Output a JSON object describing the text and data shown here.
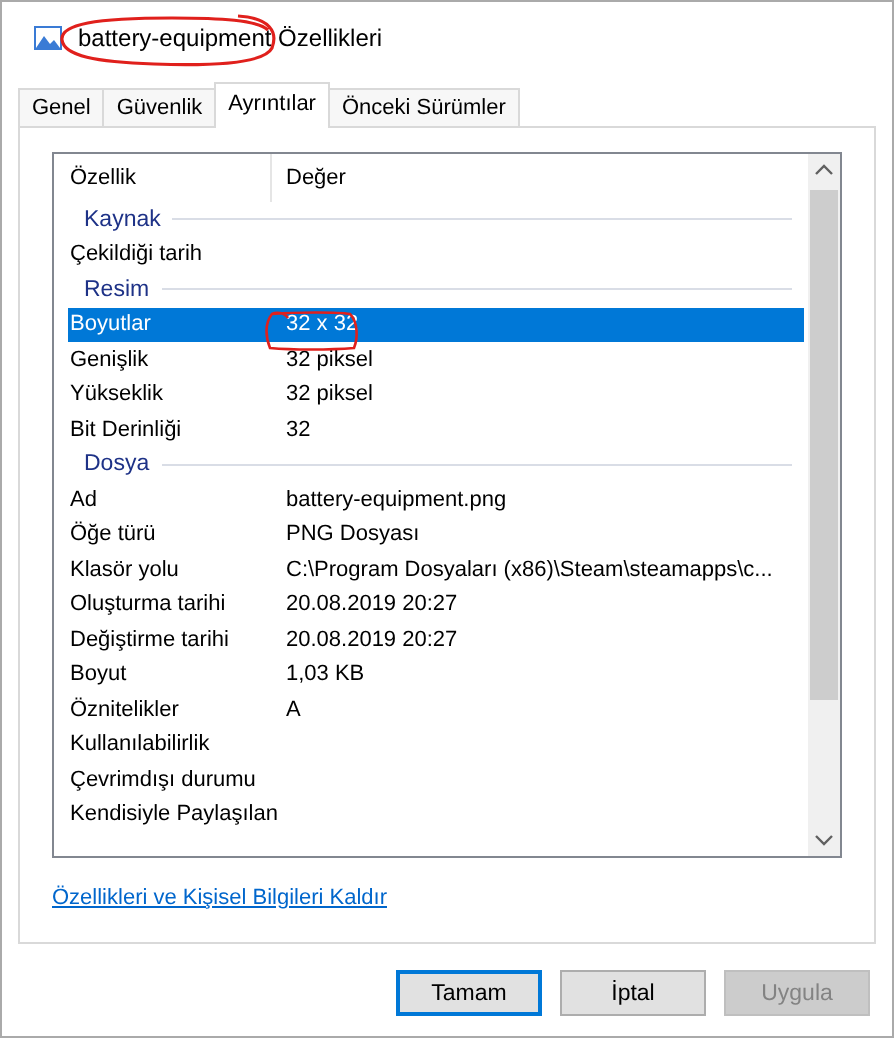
{
  "window": {
    "title": "battery-equipment Özellikleri"
  },
  "tabs": [
    {
      "label": "Genel",
      "selected": false
    },
    {
      "label": "Güvenlik",
      "selected": false
    },
    {
      "label": "Ayrıntılar",
      "selected": true
    },
    {
      "label": "Önceki Sürümler",
      "selected": false
    }
  ],
  "table": {
    "columns": [
      "Özellik",
      "Değer"
    ],
    "rows": [
      {
        "kind": "group",
        "label": "Kaynak"
      },
      {
        "kind": "property",
        "name": "Çekildiği tarih",
        "selected": false
      },
      {
        "kind": "group",
        "label": "Resim"
      },
      {
        "kind": "property",
        "name": "Boyutlar",
        "value": "32 x 32",
        "selected": true
      },
      {
        "kind": "property",
        "name": "Genişlik",
        "value": "32 piksel",
        "selected": false
      },
      {
        "kind": "property",
        "name": "Yükseklik",
        "value": "32 piksel",
        "selected": false
      },
      {
        "kind": "property",
        "name": "Bit Derinliği",
        "value": "32",
        "selected": false
      },
      {
        "kind": "group",
        "label": "Dosya"
      },
      {
        "kind": "property",
        "name": "Ad",
        "value": "battery-equipment.png",
        "selected": false
      },
      {
        "kind": "property",
        "name": "Öğe türü",
        "value": "PNG Dosyası",
        "selected": false
      },
      {
        "kind": "property",
        "name": "Klasör yolu",
        "value": "C:\\Program Dosyaları (x86)\\Steam\\steamapps\\c...",
        "selected": false
      },
      {
        "kind": "property",
        "name": "Oluşturma tarihi",
        "value": "20.08.2019 20:27",
        "selected": false
      },
      {
        "kind": "property",
        "name": "Değiştirme tarihi",
        "value": "20.08.2019 20:27",
        "selected": false
      },
      {
        "kind": "property",
        "name": "Boyut",
        "value": "1,03 KB",
        "selected": false
      },
      {
        "kind": "property",
        "name": "Öznitelikler",
        "value": "A",
        "selected": false
      },
      {
        "kind": "property",
        "name": "Kullanılabilirlik",
        "selected": false
      },
      {
        "kind": "property",
        "name": "Çevrimdışı durumu",
        "selected": false
      },
      {
        "kind": "property",
        "name": "Kendisiyle Paylaşılan",
        "selected": false
      }
    ]
  },
  "link": "Özellikleri ve Kişisel Bilgileri Kaldır",
  "buttons": [
    {
      "label": "Tamam",
      "kind": "default",
      "disabled": false
    },
    {
      "label": "İptal",
      "kind": "normal",
      "disabled": false
    },
    {
      "label": "Uygula",
      "kind": "normal",
      "disabled": true
    }
  ]
}
